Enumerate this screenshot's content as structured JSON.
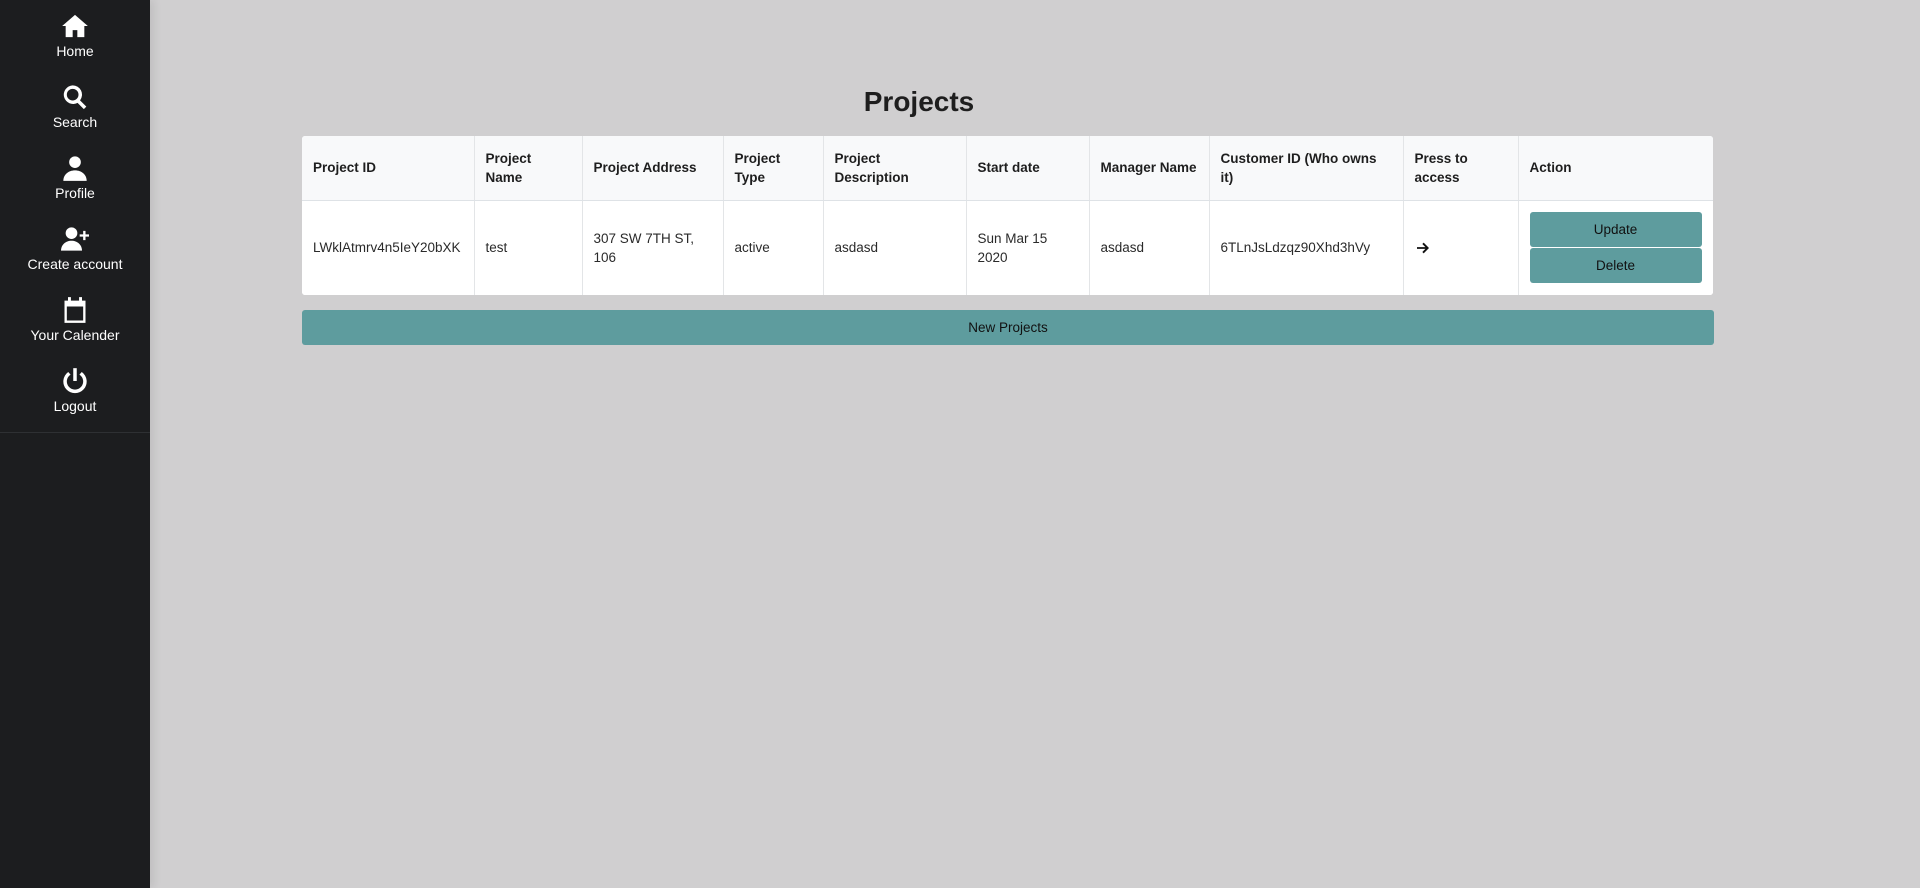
{
  "sidebar": {
    "items": [
      {
        "label": "Home",
        "icon": "home-icon"
      },
      {
        "label": "Search",
        "icon": "search-icon"
      },
      {
        "label": "Profile",
        "icon": "user-icon"
      },
      {
        "label": "Create account",
        "icon": "user-plus-icon"
      },
      {
        "label": "Your Calender",
        "icon": "calendar-icon"
      },
      {
        "label": "Logout",
        "icon": "power-icon"
      }
    ]
  },
  "page": {
    "title": "Projects"
  },
  "table": {
    "headers": [
      "Project ID",
      "Project Name",
      "Project Address",
      "Project Type",
      "Project Description",
      "Start date",
      "Manager Name",
      "Customer ID (Who owns it)",
      "Press to access",
      "Action"
    ],
    "rows": [
      {
        "project_id": "LWklAtmrv4n5IeY20bXK",
        "project_name": "test",
        "project_address": "307 SW 7TH ST, 106",
        "project_type": "active",
        "project_description": "asdasd",
        "start_date": "Sun Mar 15 2020",
        "manager_name": "asdasd",
        "customer_id": "6TLnJsLdzqz90Xhd3hVy",
        "access_icon": "arrow-right-icon",
        "update_label": "Update",
        "delete_label": "Delete"
      }
    ]
  },
  "new_projects_label": "New Projects",
  "colors": {
    "sidebar_bg": "#1c1d1f",
    "page_bg": "#d0cfd0",
    "accent": "#5e9c9e"
  }
}
